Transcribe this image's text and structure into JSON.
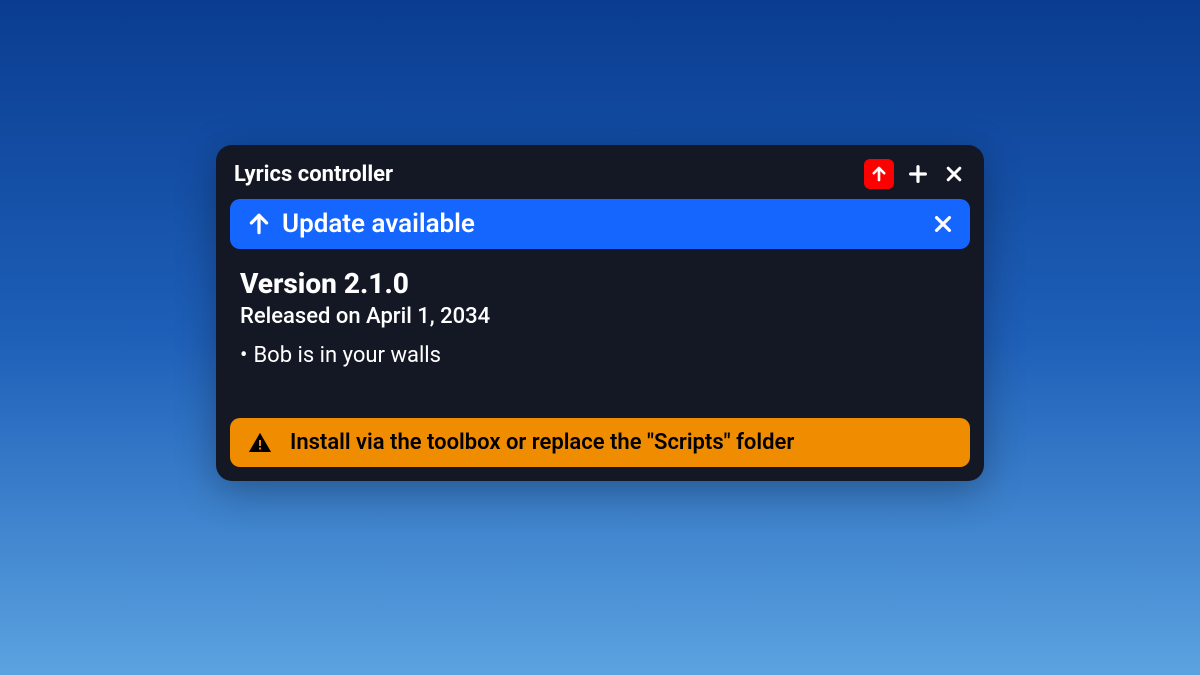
{
  "window": {
    "title": "Lyrics controller"
  },
  "update_banner": {
    "label": "Update available"
  },
  "version": {
    "title": "Version 2.1.0",
    "released": "Released on April 1, 2034",
    "changelog": [
      "Bob is in your walls"
    ]
  },
  "install_banner": {
    "text": "Install via the toolbox or replace the \"Scripts\" folder"
  }
}
